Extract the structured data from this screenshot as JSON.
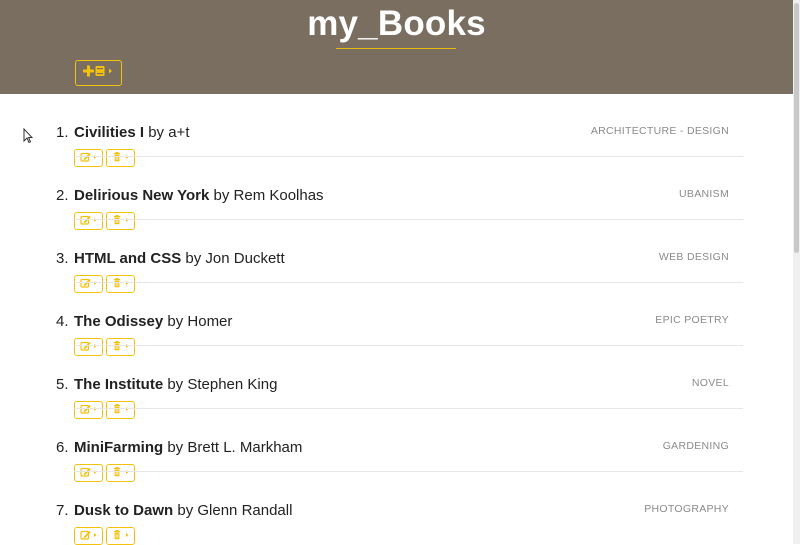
{
  "app": {
    "title": "my_Books",
    "accent_color": "#f4c20d",
    "header_color": "#7a6e61"
  },
  "toolbar": {
    "add_button_icon": "add-book-icon"
  },
  "books": [
    {
      "index": "1.",
      "title": "Civilities I",
      "by": " by ",
      "author": "a+t",
      "genre": "ARCHITECTURE - DESIGN"
    },
    {
      "index": "2.",
      "title": "Delirious New York",
      "by": " by ",
      "author": "Rem Koolhas",
      "genre": "UBANISM"
    },
    {
      "index": "3.",
      "title": "HTML and CSS",
      "by": " by ",
      "author": "Jon Duckett",
      "genre": "WEB DESIGN"
    },
    {
      "index": "4.",
      "title": "The Odissey",
      "by": " by ",
      "author": "Homer",
      "genre": "EPIC POETRY"
    },
    {
      "index": "5.",
      "title": "The Institute",
      "by": " by ",
      "author": "Stephen King",
      "genre": "NOVEL"
    },
    {
      "index": "6.",
      "title": "MiniFarming",
      "by": " by ",
      "author": "Brett L. Markham",
      "genre": "GARDENING"
    },
    {
      "index": "7.",
      "title": "Dusk to Dawn",
      "by": " by ",
      "author": "Glenn Randall",
      "genre": "PHOTOGRAPHY"
    }
  ],
  "item_actions": {
    "edit_icon": "edit-icon",
    "delete_icon": "trash-icon"
  }
}
